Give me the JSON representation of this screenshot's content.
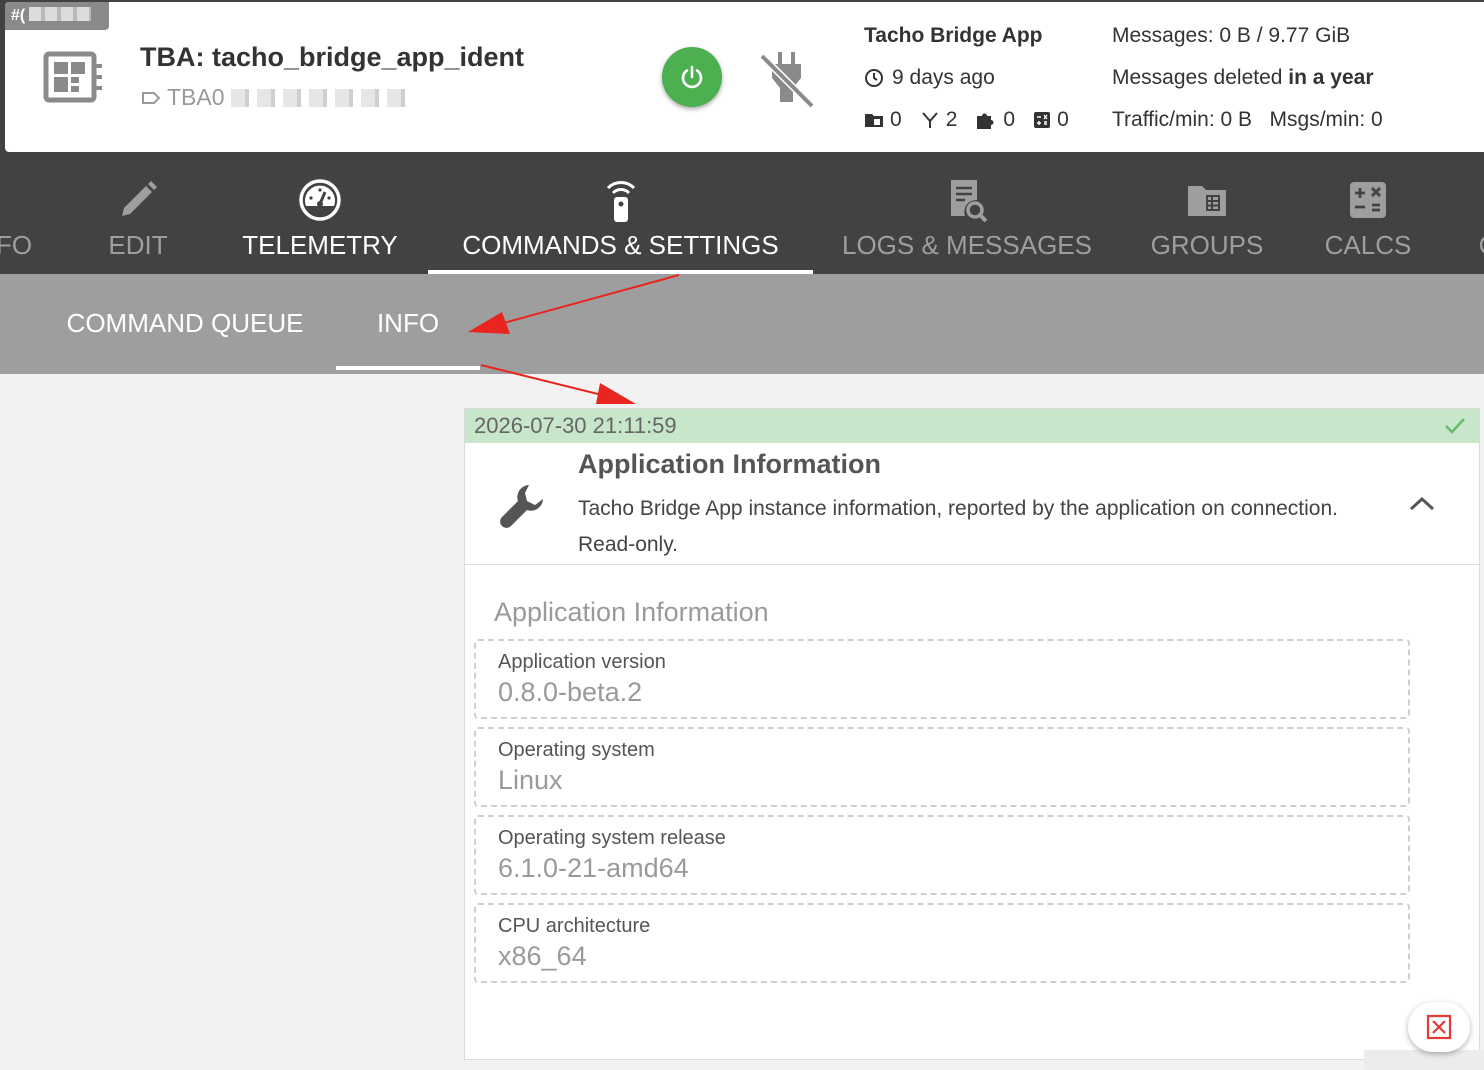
{
  "header": {
    "id_chip": "#(",
    "title": "TBA: tacho_bridge_app_ident",
    "ident": "TBA0",
    "app_name": "Tacho Bridge App",
    "last_seen": "9 days ago",
    "counters": [
      {
        "icon": "folder-icon",
        "value": "0"
      },
      {
        "icon": "fork-icon",
        "value": "2"
      },
      {
        "icon": "puzzle-icon",
        "value": "0"
      },
      {
        "icon": "calculator-icon",
        "value": "0"
      }
    ],
    "messages": "Messages: 0 B / 9.77 GiB",
    "deleted_prefix": "Messages deleted ",
    "deleted_bold": "in a year",
    "traffic": "Traffic/min: 0 B   Msgs/min: 0",
    "power_color": "#4caf50"
  },
  "main_tabs": [
    {
      "label": "FO",
      "icon": "info-icon"
    },
    {
      "label": "EDIT",
      "icon": "pencil-icon"
    },
    {
      "label": "TELEMETRY",
      "icon": "gauge-icon"
    },
    {
      "label": "COMMANDS & SETTINGS",
      "icon": "remote-icon",
      "active": true
    },
    {
      "label": "LOGS & MESSAGES",
      "icon": "log-search-icon"
    },
    {
      "label": "GROUPS",
      "icon": "folder-grid-icon"
    },
    {
      "label": "CALCS",
      "icon": "calculator-icon"
    },
    {
      "label": "C",
      "icon": ""
    }
  ],
  "sub_tabs": [
    {
      "label": "COMMAND QUEUE"
    },
    {
      "label": "INFO",
      "active": true
    }
  ],
  "card": {
    "timestamp": "2026-07-30 21:11:59",
    "status_color": "#c8e6c9",
    "title": "Application Information",
    "description": "Tacho Bridge App instance information, reported by the application on connection. Read-only.",
    "section_title": "Application Information",
    "fields": [
      {
        "label": "Application version",
        "value": "0.8.0-beta.2"
      },
      {
        "label": "Operating system",
        "value": "Linux"
      },
      {
        "label": "Operating system release",
        "value": "6.1.0-21-amd64"
      },
      {
        "label": "CPU architecture",
        "value": "x86_64"
      }
    ]
  },
  "accent_colors": {
    "arrow": "#e8261f",
    "close": "#e53935"
  }
}
